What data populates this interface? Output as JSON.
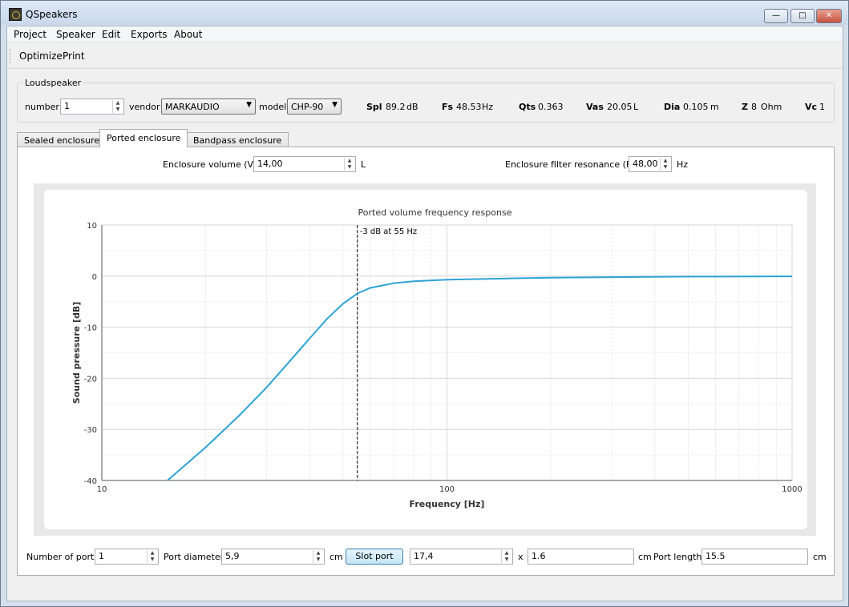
{
  "window": {
    "title": "QSpeakers"
  },
  "menu": {
    "items": [
      "Project",
      "Speaker",
      "Edit",
      "Exports",
      "About"
    ]
  },
  "toolbar": {
    "optimize": "Optimize",
    "print": "Print"
  },
  "loudspeaker": {
    "group_title": "Loudspeaker",
    "number_label": "number",
    "number_value": "1",
    "vendor_label": "vendor",
    "vendor_value": "MARKAUDIO",
    "model_label": "model",
    "model_value": "CHP-90",
    "params": [
      {
        "name": "Spl",
        "value": "89.2",
        "unit": "dB"
      },
      {
        "name": "Fs",
        "value": "48.53",
        "unit": "Hz"
      },
      {
        "name": "Qts",
        "value": "0.363",
        "unit": ""
      },
      {
        "name": "Vas",
        "value": "20.05",
        "unit": "L"
      },
      {
        "name": "Dia",
        "value": "0.105",
        "unit": "m"
      },
      {
        "name": "Z",
        "value": "8",
        "unit": "Ohm"
      },
      {
        "name": "Vc",
        "value": "1",
        "unit": ""
      }
    ]
  },
  "tabs": [
    "Sealed enclosure",
    "Ported enclosure",
    "Bandpass enclosure"
  ],
  "active_tab": 1,
  "ported": {
    "vb_label": "Enclosure volume (Vb)",
    "vb_value": "14,00",
    "vb_unit": "L",
    "fb_label": "Enclosure filter resonance (Fb)",
    "fb_value": "48,00",
    "fb_unit": "Hz",
    "ports_label": "Number of ports",
    "ports_value": "1",
    "diameter_label": "Port diameter",
    "diameter_value": "5,9",
    "diameter_unit": "cm",
    "slot_button": "Slot port",
    "slot_w_value": "17,4",
    "x_label": "x",
    "slot_h_value": "1.6",
    "slot_unit": "cm",
    "length_label": "Port length",
    "length_value": "15.5",
    "length_unit": "cm"
  },
  "chart_data": {
    "type": "line",
    "title": "Ported volume frequency response",
    "xlabel": "Frequency [Hz]",
    "ylabel": "Sound pressure [dB]",
    "x_scale": "log",
    "xlim": [
      10,
      1000
    ],
    "ylim": [
      -40,
      10
    ],
    "x_ticks": [
      10,
      100,
      1000
    ],
    "y_ticks": [
      10,
      0,
      -10,
      -20,
      -30,
      -40
    ],
    "grid": true,
    "line_color": "#2ea3d6",
    "annotation": {
      "text": "-3 dB at 55 Hz",
      "x": 55
    },
    "series": [
      {
        "x": [
          15.5,
          20,
          25,
          30,
          35,
          40,
          45,
          50,
          55,
          60,
          70,
          80,
          100,
          150,
          200,
          300,
          500,
          1000
        ],
        "y": [
          -40,
          -33.5,
          -27.3,
          -21.8,
          -16.7,
          -12.2,
          -8.3,
          -5.4,
          -3.4,
          -2.3,
          -1.4,
          -1.0,
          -0.7,
          -0.45,
          -0.32,
          -0.2,
          -0.1,
          -0.05
        ]
      }
    ]
  }
}
